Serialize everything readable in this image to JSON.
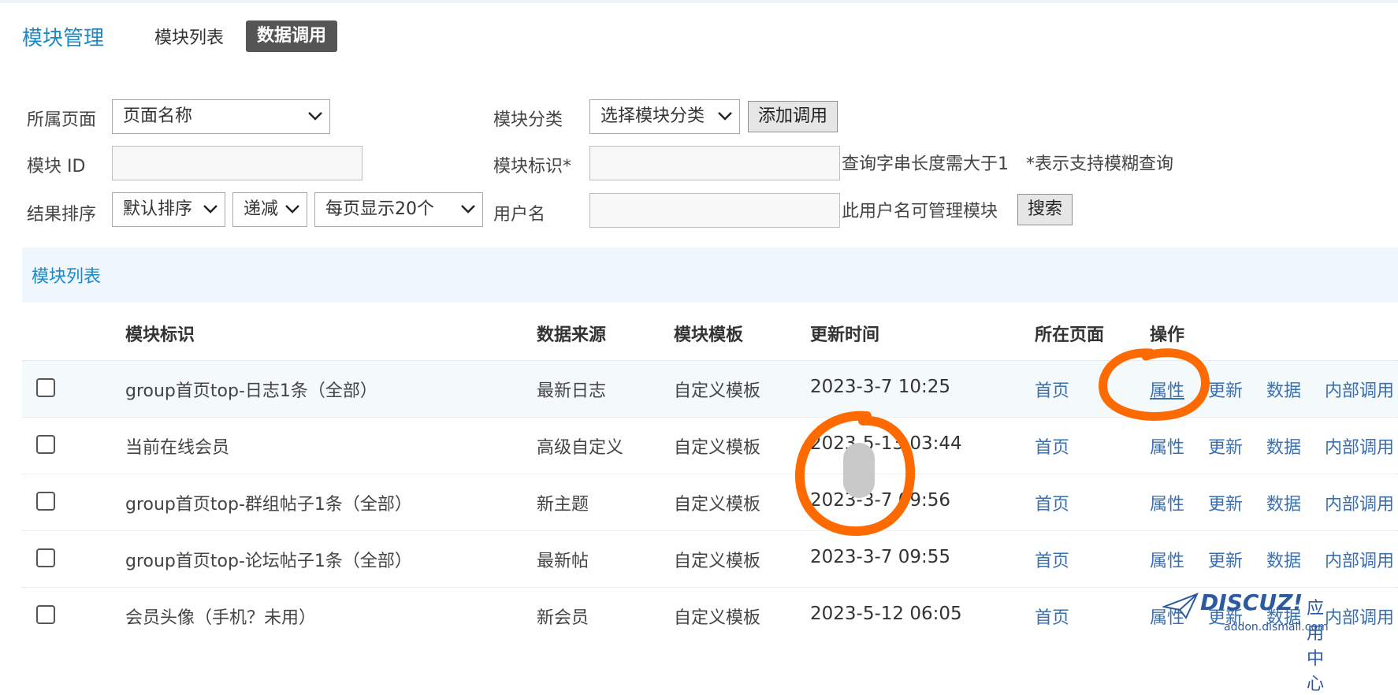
{
  "header": {
    "title": "模块管理",
    "tabs": [
      {
        "label": "模块列表",
        "active": false
      },
      {
        "label": "数据调用",
        "active": true
      }
    ]
  },
  "filters": {
    "page_label": "所属页面",
    "page_select": "页面名称",
    "category_label": "模块分类",
    "category_select": "选择模块分类",
    "add_button": "添加调用",
    "module_id_label": "模块 ID",
    "module_id_value": "",
    "module_tag_label": "模块标识*",
    "module_tag_value": "",
    "query_hint": "查询字串长度需大于1　*表示支持模糊查询",
    "sort_label": "结果排序",
    "sort_select": "默认排序",
    "order_select": "递减",
    "perpage_select": "每页显示20个",
    "username_label": "用户名",
    "username_value": "",
    "username_hint": "此用户名可管理模块",
    "search_button": "搜索"
  },
  "list": {
    "title": "模块列表",
    "columns": [
      "模块标识",
      "数据来源",
      "模块模板",
      "更新时间",
      "所在页面",
      "操作"
    ],
    "actions": [
      "属性",
      "更新",
      "数据",
      "内部调用"
    ],
    "rows": [
      {
        "name": "group首页top-日志1条（全部）",
        "source": "最新日志",
        "template": "自定义模板",
        "time": "2023-3-7 10:25",
        "page": "首页",
        "checked": false
      },
      {
        "name": "当前在线会员",
        "source": "高级自定义",
        "template": "自定义模板",
        "time": "2023-5-13 03:44",
        "page": "首页",
        "checked": false
      },
      {
        "name": "group首页top-群组帖子1条（全部）",
        "source": "新主题",
        "template": "自定义模板",
        "time": "2023-3-7 09:56",
        "page": "首页",
        "checked": false
      },
      {
        "name": "group首页top-论坛帖子1条（全部）",
        "source": "最新帖",
        "template": "自定义模板",
        "time": "2023-3-7 09:55",
        "page": "首页",
        "checked": false
      },
      {
        "name": "会员头像（手机？未用）",
        "source": "新会员",
        "template": "自定义模板",
        "time": "2023-5-12 06:05",
        "page": "首页",
        "checked": false
      }
    ]
  },
  "watermark": {
    "brand": "DISCUZ!",
    "sub": "应用中心",
    "url": "addon.dismall.com"
  },
  "colors": {
    "accent": "#1a8ac9",
    "link": "#3a6fb0",
    "highlight_mark": "#ff6a00"
  }
}
